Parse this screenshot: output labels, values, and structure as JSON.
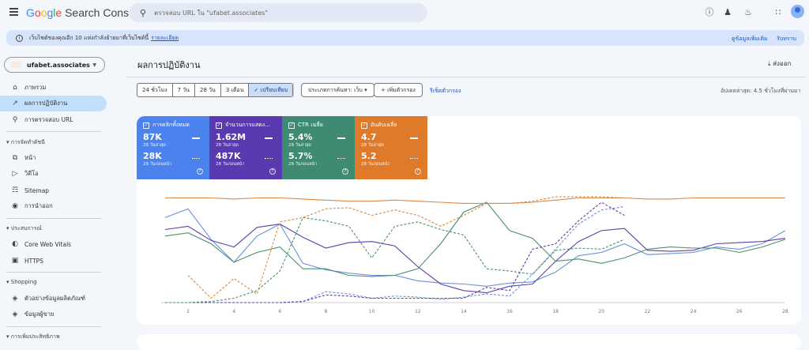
{
  "header": {
    "product": "Search Console",
    "search_placeholder": "ตรวจสอบ URL ใน \"ufabet.associates\"",
    "icons": [
      "menu-icon",
      "help-icon",
      "manage-users-icon",
      "bell-icon",
      "apps-icon",
      "avatar"
    ]
  },
  "banner": {
    "text": "เว็บไซต์ของคุณอีก 10 แห่งกำลังย้ายมาที่เว็บไซต์นี้",
    "link": "รายละเอียด",
    "more": "ดูข้อมูลเพิ่มเติม",
    "ack": "รับทราบ"
  },
  "sidebar": {
    "property": "ufabet.associates",
    "items": [
      {
        "label": "ภาพรวม",
        "icon": "home-icon"
      },
      {
        "label": "ผลการปฏิบัติงาน",
        "icon": "trending-up-icon",
        "active": true
      },
      {
        "label": "การตรวจสอบ URL",
        "icon": "search-icon"
      }
    ],
    "sections": [
      {
        "title": "การจัดทำดัชนี",
        "items": [
          {
            "label": "หน้า",
            "icon": "pages-icon"
          },
          {
            "label": "วิดีโอ",
            "icon": "video-icon"
          },
          {
            "label": "Sitemap",
            "icon": "sitemap-icon"
          },
          {
            "label": "การนำออก",
            "icon": "removal-icon"
          }
        ]
      },
      {
        "title": "ประสบการณ์",
        "items": [
          {
            "label": "Core Web Vitals",
            "icon": "gauge-icon"
          },
          {
            "label": "HTTPS",
            "icon": "lock-icon"
          }
        ]
      },
      {
        "title": "Shopping",
        "items": [
          {
            "label": "ตัวอย่างข้อมูลผลิตภัณฑ์",
            "icon": "diamond-icon"
          },
          {
            "label": "ข้อมูลผู้ขาย",
            "icon": "diamond-icon"
          }
        ]
      },
      {
        "title": "การเพิ่มประสิทธิภาพ",
        "items": []
      }
    ]
  },
  "main": {
    "title": "ผลการปฏิบัติงาน",
    "export": "ส่งออก",
    "ranges": [
      "24 ชั่วโมง",
      "7 วัน",
      "28 วัน",
      "3 เดือน",
      "เปรียบเทียบ"
    ],
    "search_type": "ประเภทการค้นหา: เว็บ",
    "add_filter": "เพิ่มตัวกรอง",
    "reset": "รีเซ็ตตัวกรอง",
    "updated": "อัปเดตล่าสุด: 4.5 ชั่วโมงที่ผ่านมา"
  },
  "cards": [
    {
      "label": "การคลิกทั้งหมด",
      "current": "87K",
      "current_label": "28 วันล่าสุด",
      "previous": "28K",
      "previous_label": "28 วันก่อนหน้า",
      "color": "#4c82ee"
    },
    {
      "label": "จำนวนการแสดง...",
      "current": "1.62M",
      "current_label": "28 วันล่าสุด",
      "previous": "487K",
      "previous_label": "28 วันก่อนหน้า",
      "color": "#5a3ab0"
    },
    {
      "label": "CTR เฉลี่ย",
      "current": "5.4%",
      "current_label": "28 วันล่าสุด",
      "previous": "5.7%",
      "previous_label": "28 วันก่อนหน้า",
      "color": "#3e8a72"
    },
    {
      "label": "อันดับเฉลี่ย",
      "current": "4.7",
      "current_label": "28 วันล่าสุด",
      "previous": "5.2",
      "previous_label": "28 วันก่อนหน้า",
      "color": "#e07a2b"
    }
  ],
  "chart_data": {
    "type": "line",
    "x": [
      1,
      2,
      3,
      4,
      5,
      6,
      7,
      8,
      9,
      10,
      11,
      12,
      13,
      14,
      15,
      16,
      17,
      18,
      19,
      20,
      21,
      22,
      23,
      24,
      25,
      26,
      27,
      28
    ],
    "x_ticks": [
      "2",
      "4",
      "6",
      "8",
      "10",
      "12",
      "14",
      "16",
      "18",
      "20",
      "22",
      "24",
      "26",
      "28"
    ],
    "scale": "relative 0-100 per series (no y-axis printed)",
    "series": [
      {
        "metric": "clicks",
        "period": "current",
        "color": "#6a90dc",
        "style": "solid",
        "values": [
          78,
          86,
          58,
          37,
          61,
          72,
          36,
          30,
          27,
          25,
          25,
          20,
          18,
          17,
          15,
          18,
          19,
          28,
          43,
          46,
          54,
          44,
          45,
          46,
          51,
          49,
          54,
          66
        ]
      },
      {
        "metric": "impressions",
        "period": "current",
        "color": "#5e3fa8",
        "style": "solid",
        "values": [
          67,
          70,
          57,
          51,
          69,
          72,
          60,
          50,
          55,
          56,
          52,
          33,
          17,
          11,
          9,
          15,
          17,
          38,
          56,
          66,
          68,
          48,
          47,
          48,
          54,
          55,
          56,
          59
        ]
      },
      {
        "metric": "ctr",
        "period": "current",
        "color": "#4a8f6e",
        "style": "solid",
        "values": [
          61,
          64,
          54,
          37,
          46,
          51,
          31,
          31,
          25,
          24,
          25,
          31,
          54,
          83,
          92,
          66,
          59,
          38,
          40,
          36,
          41,
          49,
          51,
          50,
          50,
          46,
          51,
          58
        ]
      },
      {
        "metric": "position",
        "period": "current",
        "color": "#d98845",
        "style": "solid",
        "values": [
          96,
          96,
          96,
          95,
          96,
          96,
          95,
          94,
          93,
          93,
          94,
          93,
          92,
          91,
          91,
          91,
          92,
          94,
          96,
          96,
          96,
          95,
          95,
          96,
          96,
          96,
          96,
          96
        ]
      },
      {
        "metric": "clicks",
        "period": "previous",
        "color": "#6a90dc",
        "style": "dashed",
        "values": [
          0,
          0,
          0,
          0,
          0,
          0,
          1,
          10,
          8,
          4,
          6,
          5,
          3,
          5,
          8,
          6,
          26,
          49,
          72,
          85,
          88,
          null,
          null,
          null,
          null,
          null,
          null,
          null
        ]
      },
      {
        "metric": "impressions",
        "period": "previous",
        "color": "#5e3fa8",
        "style": "dashed",
        "values": [
          0,
          0,
          0,
          0,
          0,
          0,
          1,
          7,
          6,
          4,
          4,
          4,
          4,
          4,
          14,
          11,
          49,
          54,
          75,
          92,
          80,
          null,
          null,
          null,
          null,
          null,
          null,
          null
        ]
      },
      {
        "metric": "ctr",
        "period": "previous",
        "color": "#4a8f6e",
        "style": "dashed",
        "values": [
          0,
          0,
          1,
          4,
          11,
          29,
          78,
          75,
          70,
          41,
          70,
          74,
          67,
          62,
          31,
          29,
          26,
          48,
          50,
          49,
          58,
          null,
          null,
          null,
          null,
          null,
          null,
          null
        ]
      },
      {
        "metric": "position",
        "period": "previous",
        "color": "#d98845",
        "style": "dashed",
        "values": [
          null,
          25,
          4,
          22,
          8,
          74,
          78,
          86,
          87,
          80,
          85,
          80,
          70,
          80,
          91,
          91,
          93,
          97,
          97,
          97,
          96,
          null,
          null,
          null,
          null,
          null,
          null,
          null
        ]
      }
    ]
  }
}
